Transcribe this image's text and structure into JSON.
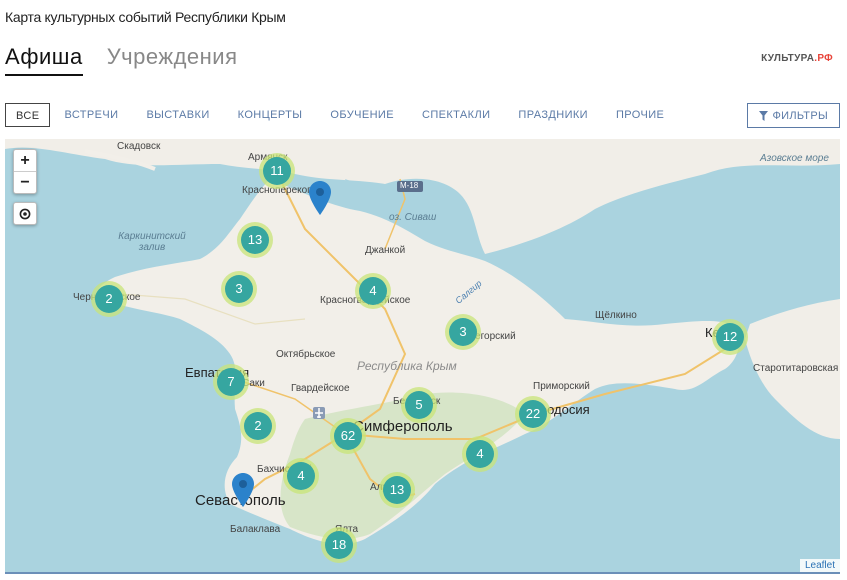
{
  "header": {
    "title": "Карта культурных событий Республики Крым"
  },
  "tabs": [
    {
      "label": "Афиша"
    },
    {
      "label": "Учреждения"
    }
  ],
  "brand": {
    "main": "КУЛЬТУРА",
    "suffix": ".РФ"
  },
  "categories": [
    {
      "label": "ВСЕ"
    },
    {
      "label": "ВСТРЕЧИ"
    },
    {
      "label": "ВЫСТАВКИ"
    },
    {
      "label": "КОНЦЕРТЫ"
    },
    {
      "label": "ОБУЧЕНИЕ"
    },
    {
      "label": "СПЕКТАКЛИ"
    },
    {
      "label": "ПРАЗДНИКИ"
    },
    {
      "label": "ПРОЧИЕ"
    }
  ],
  "filters": {
    "label": "ФИЛЬТРЫ"
  },
  "map": {
    "zoom_in": "+",
    "zoom_out": "−",
    "attribution": "Leaflet",
    "clusters": [
      "11",
      "13",
      "3",
      "2",
      "4",
      "3",
      "12",
      "7",
      "2",
      "5",
      "22",
      "62",
      "4",
      "4",
      "13",
      "18"
    ],
    "labels": {
      "skadovsk": "Скадовск",
      "sea_azov": "Азовское море",
      "gulf_karkinit": "Каркинитский залив",
      "armyansk": "Армянск",
      "krasnoperekopsk": "Красноперекопск",
      "ozero_sivash": "оз. Сиваш",
      "dzhankoy": "Джанкой",
      "chernomorskoe": "Черноморское",
      "krasnogvardeyskoe": "Красногвардейское",
      "oktyabrskoe": "Октябрьское",
      "nizhnegorsky": "Нижнегорский",
      "respublika": "Республика Крым",
      "evpatoria": "Евпатория",
      "saki": "Саки",
      "gvardeyskoe": "Гвардейское",
      "belogorsk": "Белогорск",
      "simferopol": "Симферополь",
      "feodosia": "Феодосия",
      "primorsky": "Приморский",
      "shchelkino": "Щёлкино",
      "kerch": "Керчь",
      "starotitarovskaya": "Старотитаровская",
      "bakhchisaray": "Бахчисарай",
      "alushta": "Алушта",
      "sevastopol": "Севастополь",
      "balaklava": "Балаклава",
      "yalta": "Ялта",
      "road_m18": "М-18",
      "salgir": "Салгир"
    }
  }
}
